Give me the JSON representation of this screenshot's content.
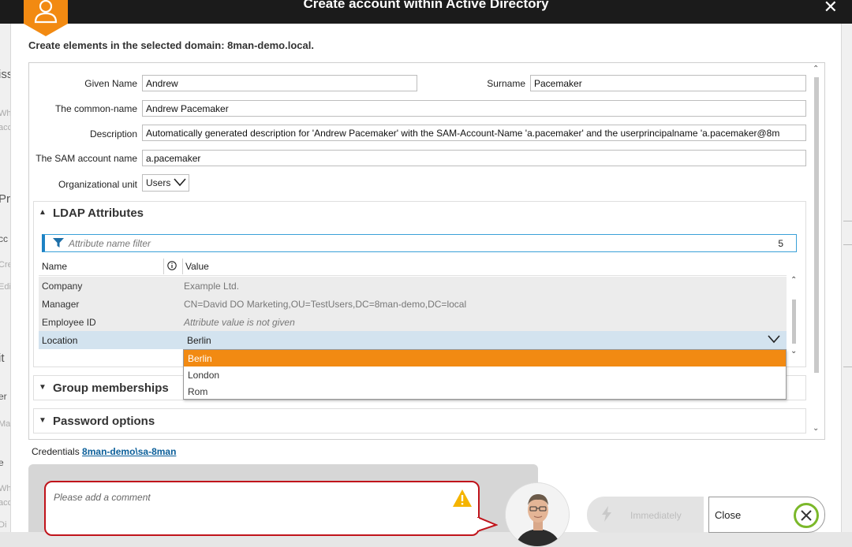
{
  "window": {
    "title": "Create account within Active Directory"
  },
  "background": {
    "left_fragments": [
      "iss",
      "Wh",
      "acc",
      "Pr",
      "cc",
      "Cre",
      "Edi",
      "it",
      "er",
      "Ma",
      "e",
      "Wh",
      "acc",
      "Di"
    ]
  },
  "header": {
    "subtitle": "Create elements in the selected domain: 8man-demo.local."
  },
  "form": {
    "given_name_label": "Given Name",
    "given_name_value": "Andrew",
    "surname_label": "Surname",
    "surname_value": "Pacemaker",
    "common_name_label": "The common-name",
    "common_name_value": "Andrew Pacemaker",
    "description_label": "Description",
    "description_value": "Automatically generated description for 'Andrew Pacemaker' with the SAM-Account-Name 'a.pacemaker' and the userprincipalname 'a.pacemaker@8m",
    "sam_label": "The SAM account name",
    "sam_value": "a.pacemaker",
    "ou_label": "Organizational unit",
    "ou_value": "Users"
  },
  "ldap": {
    "title": "LDAP Attributes",
    "filter_placeholder": "Attribute name filter",
    "filter_count": "5",
    "col_name": "Name",
    "col_info_icon": "info-icon",
    "col_value": "Value",
    "rows": [
      {
        "name": "Company",
        "value": "Example Ltd."
      },
      {
        "name": "Manager",
        "value": "CN=David DO Marketing,OU=TestUsers,DC=8man-demo,DC=local"
      },
      {
        "name": "Employee ID",
        "value": "Attribute value is not given"
      },
      {
        "name": "Location",
        "value": "Berlin"
      }
    ],
    "dropdown_options": [
      "Berlin",
      "London",
      "Rom"
    ],
    "dropdown_highlight_color": "#f28a12"
  },
  "sections": {
    "group_memberships": "Group memberships",
    "password_options": "Password options"
  },
  "credentials": {
    "label": "Credentials",
    "account": "8man-demo\\sa-8man"
  },
  "comment": {
    "placeholder": "Please add a comment"
  },
  "buttons": {
    "immediately": "Immediately",
    "close": "Close"
  },
  "colors": {
    "accent_orange": "#f28a12",
    "comment_border": "#c0141b",
    "close_circle": "#7bb82a",
    "titlebar": "#1b1b1b"
  }
}
